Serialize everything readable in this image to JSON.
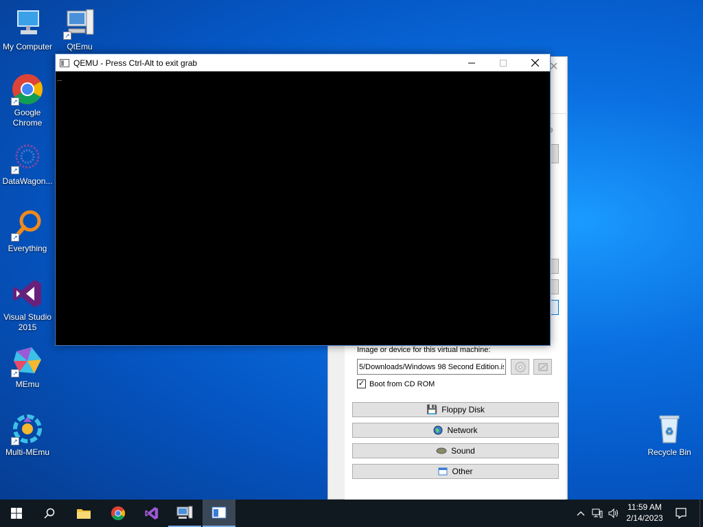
{
  "desktop": {
    "icons": [
      {
        "label": "My Computer"
      },
      {
        "label": "QtEmu"
      },
      {
        "label": "Google Chrome"
      },
      {
        "label": "DataWagon..."
      },
      {
        "label": "Everything"
      },
      {
        "label": "Visual Studio 2015"
      },
      {
        "label": "MEmu"
      },
      {
        "label": "Multi-MEmu"
      },
      {
        "label": "Recycle Bin"
      }
    ]
  },
  "qemu_window": {
    "title": "QEMU - Press Ctrl-Alt to exit grab",
    "cursor": "_"
  },
  "qtemu_window": {
    "image_label": "Image or device for this virtual machine:",
    "image_path": "5/Downloads/Windows 98 Second Edition.iso",
    "boot_label": "Boot from CD ROM",
    "boot_checked": true,
    "buttons": {
      "floppy": "Floppy Disk",
      "network": "Network",
      "sound": "Sound",
      "other": "Other"
    }
  },
  "taskbar": {
    "time": "11:59 AM",
    "date": "2/14/2023"
  },
  "colors": {
    "taskbar": "#101820",
    "accent": "#0078d7"
  }
}
